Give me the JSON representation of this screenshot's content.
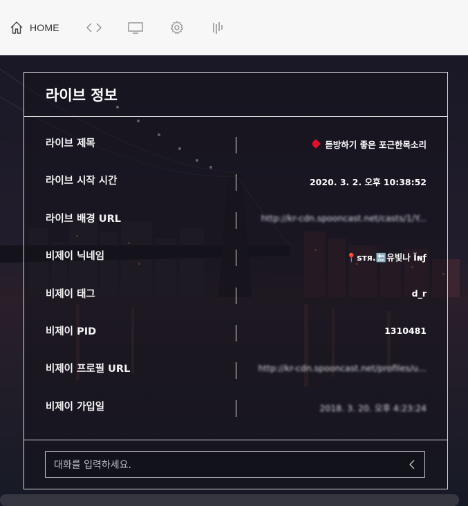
{
  "toolbar": {
    "home_label": "HOME",
    "icons": [
      "home-icon",
      "code-icon",
      "monitor-icon",
      "gear-icon",
      "equalizer-icon"
    ]
  },
  "panel": {
    "title": "라이브 정보",
    "rows": [
      {
        "label": "라이브 제목",
        "value": "듣방하기 좋은 포근한목소리"
      },
      {
        "label": "라이브 시작 시간",
        "value": "2020. 3. 2. 오후 10:38:52"
      },
      {
        "label": "라이브 배경 URL",
        "value": "http://kr-cdn.spooncast.net/casts/1/Y..."
      },
      {
        "label": "비제이 닉네임",
        "value": "📍sтя.🔚유빛나 Ĩɴƒ"
      },
      {
        "label": "비제이 태그",
        "value": "d_r"
      },
      {
        "label": "비제이 PID",
        "value": "1310481"
      },
      {
        "label": "비제이 프로필 URL",
        "value": "http://kr-cdn.spooncast.net/profiles/u..."
      },
      {
        "label": "비제이 가입일",
        "value": "2018. 3. 20. 오후 4:23:24"
      }
    ]
  },
  "chat": {
    "placeholder": "대화를 입력하세요."
  },
  "colors": {
    "toolbar_bg": "#f7f7f7",
    "panel_border": "#ffffff",
    "accent_heart": "#e0102a"
  }
}
